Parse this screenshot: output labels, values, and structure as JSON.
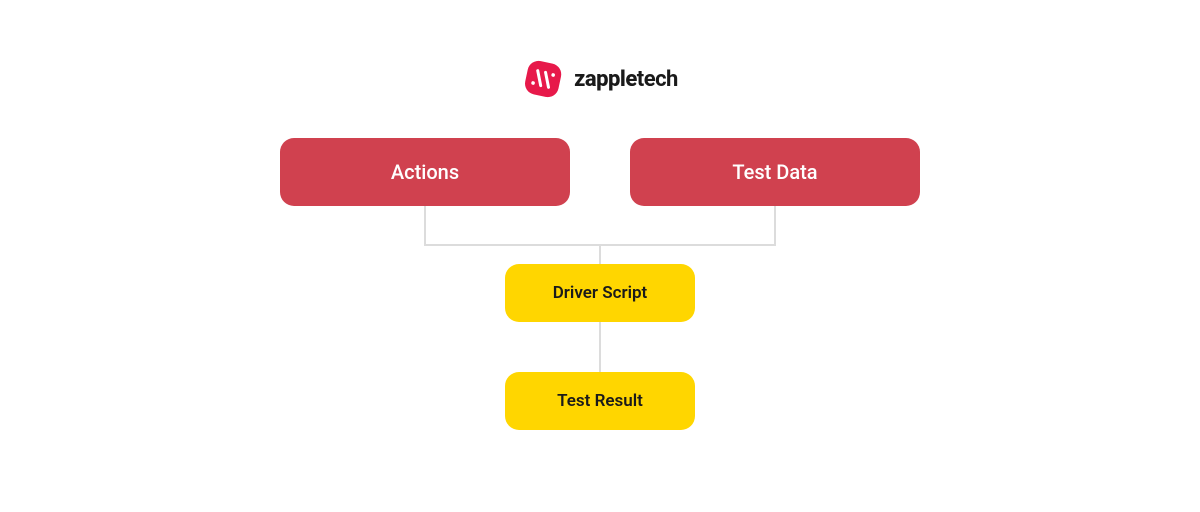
{
  "brand": {
    "name_prefix": "zapple",
    "name_suffix": "tech",
    "logo_color": "#e7194a"
  },
  "nodes": {
    "actions": "Actions",
    "test_data": "Test Data",
    "driver_script": "Driver Script",
    "test_result": "Test Result"
  },
  "colors": {
    "red": "#d0414f",
    "yellow": "#ffd600",
    "connector": "#dcdcdc"
  }
}
